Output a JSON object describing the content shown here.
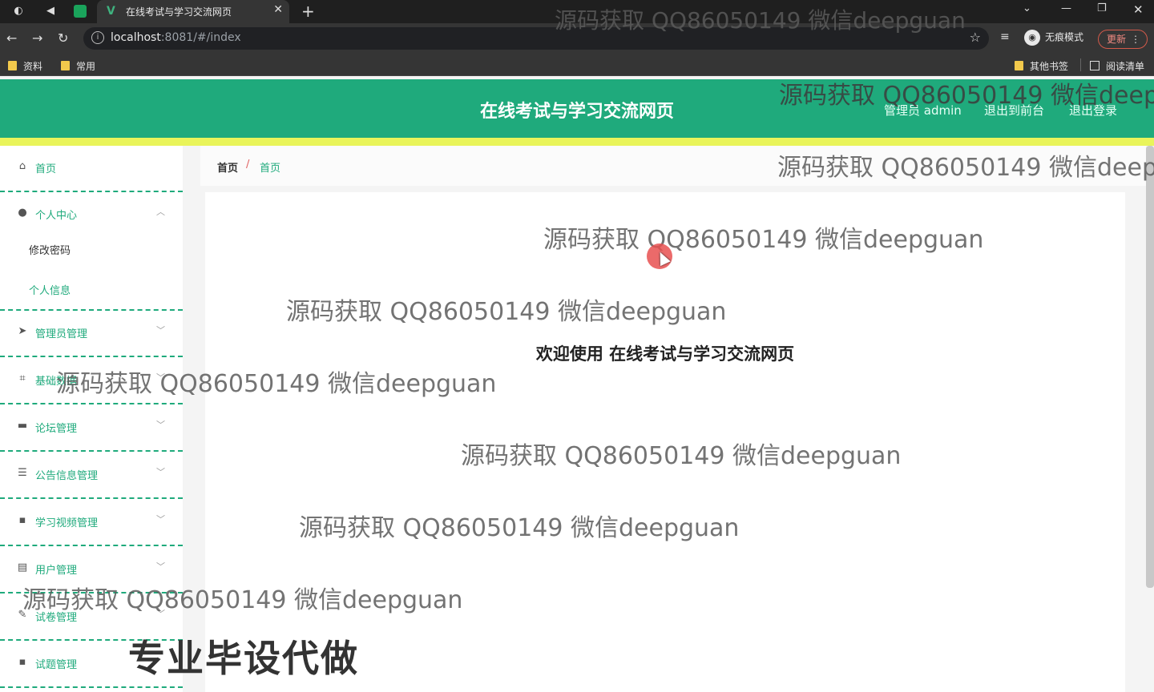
{
  "browser": {
    "tab_title": "在线考试与学习交流网页",
    "url_host": "localhost",
    "url_rest": ":8081/#/index",
    "incognito_label": "无痕模式",
    "update_label": "更新",
    "bookmarks": [
      "资料",
      "常用"
    ],
    "bookmarks_right": [
      "其他书签",
      "阅读清单"
    ]
  },
  "header": {
    "title": "在线考试与学习交流网页",
    "user_label": "管理员 admin",
    "front_link": "退出到前台",
    "logout_link": "退出登录"
  },
  "sidebar": {
    "items": [
      {
        "label": "首页",
        "icon": "home-icon"
      },
      {
        "label": "个人中心",
        "icon": "user-icon",
        "expanded": true
      },
      {
        "label": "管理员管理",
        "icon": "send-icon"
      },
      {
        "label": "基础数据",
        "icon": "crop-icon"
      },
      {
        "label": "论坛管理",
        "icon": "briefcase-icon"
      },
      {
        "label": "公告信息管理",
        "icon": "list-icon"
      },
      {
        "label": "学习视频管理",
        "icon": "chat-icon"
      },
      {
        "label": "用户管理",
        "icon": "document-icon"
      },
      {
        "label": "试卷管理",
        "icon": "pen-icon"
      },
      {
        "label": "试题管理",
        "icon": "chat-icon"
      }
    ],
    "sub_items": [
      {
        "label": "修改密码",
        "active": false
      },
      {
        "label": "个人信息",
        "active": true
      }
    ]
  },
  "breadcrumb": {
    "home": "首页",
    "separator": "/",
    "current": "首页"
  },
  "main": {
    "welcome": "欢迎使用 在线考试与学习交流网页"
  },
  "overlay": {
    "watermark": "源码获取 QQ86050149 微信deepguan",
    "watermark_cut": "源码获取 QQ86050149 微信deep",
    "promo": "专业毕设代做"
  },
  "colors": {
    "brand": "#1faa7c",
    "highlight": "#e9f45a"
  }
}
